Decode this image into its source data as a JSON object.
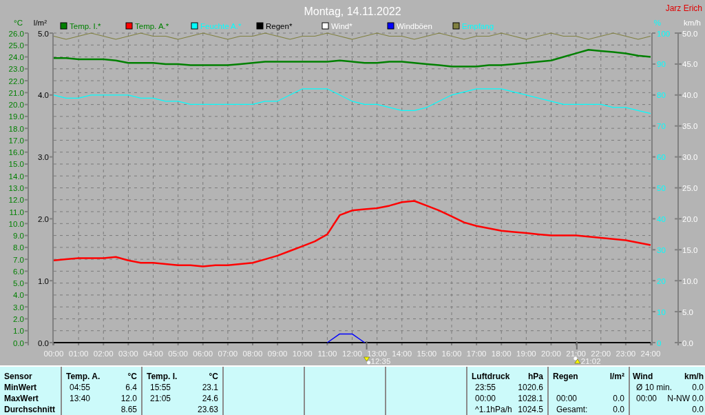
{
  "chart": {
    "author": "Jarz Erich",
    "rain_axis": {
      "title": "l/m²",
      "ticks": [
        "5.0",
        "4.0",
        "3.0",
        "2.0",
        "1.0",
        "0.0"
      ]
    },
    "markers": [
      {
        "kind": "down"
      },
      {
        "kind": "up"
      }
    ],
    "chart_data": {
      "type": "line",
      "title": "Montag, 14.11.2022",
      "grid": true,
      "legend": true,
      "xlim": [
        0,
        24
      ],
      "ylim": [
        0,
        26
      ],
      "y2lim": [
        0,
        100
      ],
      "y3lim": [
        0,
        50
      ],
      "ylabel": "°C",
      "y2label": "%",
      "y3label": "km/h",
      "x": [
        0,
        0.5,
        1,
        1.5,
        2,
        2.5,
        3,
        3.5,
        4,
        4.5,
        5,
        5.5,
        6,
        6.5,
        7,
        7.5,
        8,
        8.5,
        9,
        9.5,
        10,
        10.5,
        11,
        11.5,
        12,
        12.5,
        13,
        13.5,
        14,
        14.5,
        15,
        15.5,
        16,
        16.5,
        17,
        17.5,
        18,
        18.5,
        19,
        19.5,
        20,
        20.5,
        21,
        21.5,
        22,
        22.5,
        23,
        23.5,
        24
      ],
      "xticks": [
        {
          "value": 0,
          "label": "00:00"
        },
        {
          "value": 1,
          "label": "01:00"
        },
        {
          "value": 2,
          "label": "02:00"
        },
        {
          "value": 3,
          "label": "03:00"
        },
        {
          "value": 4,
          "label": "04:00"
        },
        {
          "value": 5,
          "label": "05:00"
        },
        {
          "value": 6,
          "label": "06:00"
        },
        {
          "value": 7,
          "label": "07:00"
        },
        {
          "value": 8,
          "label": "08:00"
        },
        {
          "value": 9,
          "label": "09:00"
        },
        {
          "value": 10,
          "label": "10:00"
        },
        {
          "value": 11,
          "label": "11:00"
        },
        {
          "value": 12,
          "label": "12:00"
        },
        {
          "value": 13,
          "label": "13:00"
        },
        {
          "value": 14,
          "label": "14:00"
        },
        {
          "value": 15,
          "label": "15:00"
        },
        {
          "value": 16,
          "label": "16:00"
        },
        {
          "value": 17,
          "label": "17:00"
        },
        {
          "value": 18,
          "label": "18:00"
        },
        {
          "value": 19,
          "label": "19:00"
        },
        {
          "value": 20,
          "label": "20:00"
        },
        {
          "value": 21,
          "label": "21:00"
        },
        {
          "value": 22,
          "label": "22:00"
        },
        {
          "value": 23,
          "label": "23:00"
        },
        {
          "value": 24,
          "label": "24:00"
        }
      ],
      "yticks": [
        {
          "value": 0,
          "label": "0.0"
        },
        {
          "value": 1,
          "label": "1.0"
        },
        {
          "value": 2,
          "label": "2.0"
        },
        {
          "value": 3,
          "label": "3.0"
        },
        {
          "value": 4,
          "label": "4.0"
        },
        {
          "value": 5,
          "label": "5.0"
        },
        {
          "value": 6,
          "label": "6.0"
        },
        {
          "value": 7,
          "label": "7.0"
        },
        {
          "value": 8,
          "label": "8.0"
        },
        {
          "value": 9,
          "label": "9.0"
        },
        {
          "value": 10,
          "label": "10.0"
        },
        {
          "value": 11,
          "label": "11.0"
        },
        {
          "value": 12,
          "label": "12.0"
        },
        {
          "value": 13,
          "label": "13.0"
        },
        {
          "value": 14,
          "label": "14.0"
        },
        {
          "value": 15,
          "label": "15.0"
        },
        {
          "value": 16,
          "label": "16.0"
        },
        {
          "value": 17,
          "label": "17.0"
        },
        {
          "value": 18,
          "label": "18.0"
        },
        {
          "value": 19,
          "label": "19.0"
        },
        {
          "value": 20,
          "label": "20.0"
        },
        {
          "value": 21,
          "label": "21.0"
        },
        {
          "value": 22,
          "label": "22.0"
        },
        {
          "value": 23,
          "label": "23.0"
        },
        {
          "value": 24,
          "label": "24.0"
        },
        {
          "value": 25,
          "label": "25.0"
        },
        {
          "value": 26,
          "label": "26.0"
        }
      ],
      "y2ticks": [
        0,
        10,
        20,
        30,
        40,
        50,
        60,
        70,
        80,
        90,
        100
      ],
      "y3ticks": [
        {
          "value": 0,
          "label": "0.0"
        },
        {
          "value": 5,
          "label": "5.0"
        },
        {
          "value": 10,
          "label": "10.0"
        },
        {
          "value": 15,
          "label": "15.0"
        },
        {
          "value": 20,
          "label": "20.0"
        },
        {
          "value": 25,
          "label": "25.0"
        },
        {
          "value": 30,
          "label": "30.0"
        },
        {
          "value": 35,
          "label": "35.0"
        },
        {
          "value": 40,
          "label": "40.0"
        },
        {
          "value": 45,
          "label": "45.0"
        },
        {
          "value": 50,
          "label": "50.0"
        }
      ],
      "series": [
        {
          "name": "Temp. I.*",
          "color": "#008000",
          "values": [
            23.9,
            23.9,
            23.8,
            23.8,
            23.8,
            23.7,
            23.5,
            23.5,
            23.5,
            23.4,
            23.4,
            23.3,
            23.3,
            23.3,
            23.3,
            23.4,
            23.5,
            23.6,
            23.6,
            23.6,
            23.6,
            23.6,
            23.6,
            23.7,
            23.6,
            23.5,
            23.5,
            23.6,
            23.6,
            23.5,
            23.4,
            23.3,
            23.2,
            23.2,
            23.2,
            23.3,
            23.3,
            23.4,
            23.5,
            23.6,
            23.7,
            24.0,
            24.3,
            24.6,
            24.5,
            24.4,
            24.3,
            24.1,
            24.0
          ]
        },
        {
          "name": "Temp. A.*",
          "color": "#ff0000",
          "values": [
            6.9,
            7.0,
            7.1,
            7.1,
            7.1,
            7.2,
            6.9,
            6.7,
            6.7,
            6.6,
            6.5,
            6.5,
            6.4,
            6.5,
            6.5,
            6.6,
            6.7,
            7.0,
            7.3,
            7.7,
            8.1,
            8.5,
            9.1,
            10.7,
            11.1,
            11.2,
            11.3,
            11.5,
            11.8,
            11.9,
            11.5,
            11.1,
            10.6,
            10.1,
            9.8,
            9.6,
            9.4,
            9.3,
            9.2,
            9.1,
            9.0,
            9.0,
            9.0,
            8.9,
            8.8,
            8.7,
            8.6,
            8.4,
            8.2
          ]
        },
        {
          "name": "Feuchte A.*",
          "color": "#00ffff",
          "axis": "y2",
          "values": [
            80,
            79,
            79,
            80,
            80,
            80,
            80,
            79,
            79,
            78,
            78,
            77,
            77,
            77,
            77,
            77,
            77,
            78,
            78,
            80,
            82,
            82,
            82,
            80,
            78,
            77,
            77,
            76,
            75,
            75,
            76,
            78,
            80,
            81,
            82,
            82,
            82,
            81,
            80,
            79,
            78,
            77,
            77,
            77,
            77,
            76,
            76,
            75,
            74
          ]
        },
        {
          "name": "Regen*",
          "color": "#000000",
          "values": [
            0,
            0,
            0,
            0,
            0,
            0,
            0,
            0,
            0,
            0,
            0,
            0,
            0,
            0,
            0,
            0,
            0,
            0,
            0,
            0,
            0,
            0,
            0,
            0,
            0,
            0,
            0,
            0,
            0,
            0,
            0,
            0,
            0,
            0,
            0,
            0,
            0,
            0,
            0,
            0,
            0,
            0,
            0,
            0,
            0,
            0,
            0,
            0,
            0
          ]
        },
        {
          "name": "Wind*",
          "color": "#ffffff",
          "axis": "y3",
          "values": [
            null,
            null,
            null,
            null,
            null,
            null,
            null,
            null,
            null,
            null,
            null,
            null,
            null,
            null,
            null,
            null,
            null,
            null,
            null,
            null,
            null,
            null,
            null,
            null,
            null,
            null,
            null,
            null,
            null,
            null,
            null,
            null,
            null,
            null,
            null,
            null,
            null,
            null,
            null,
            null,
            null,
            null,
            null,
            null,
            null,
            null,
            null,
            null,
            null
          ]
        },
        {
          "name": "Windböen",
          "color": "#0000ff",
          "axis": "y3",
          "values": [
            null,
            null,
            null,
            null,
            null,
            null,
            null,
            null,
            null,
            null,
            null,
            null,
            null,
            null,
            null,
            null,
            null,
            null,
            null,
            null,
            null,
            null,
            0,
            1.4,
            1.4,
            0,
            null,
            null,
            null,
            null,
            null,
            null,
            null,
            null,
            null,
            null,
            null,
            null,
            null,
            null,
            null,
            null,
            null,
            null,
            null,
            null,
            null,
            null,
            null
          ]
        },
        {
          "name": "Empfang",
          "color": "#808040",
          "axis": "y2",
          "values": [
            99,
            98,
            99,
            100,
            99,
            98,
            99,
            100,
            99,
            99,
            98,
            99,
            100,
            99,
            98,
            99,
            99,
            100,
            99,
            98,
            99,
            99,
            100,
            99,
            98,
            99,
            100,
            99,
            99,
            98,
            99,
            100,
            99,
            98,
            99,
            99,
            100,
            99,
            98,
            99,
            100,
            99,
            99,
            98,
            99,
            100,
            99,
            98,
            99
          ]
        }
      ],
      "annotations": [
        "12:35",
        "21:02"
      ]
    }
  },
  "table": {
    "row_labels": [
      "Sensor",
      "MinWert",
      "MaxWert",
      "Durchschnitt"
    ],
    "columns": [
      {
        "kind": "data",
        "title": "Temp. A.",
        "unit": "°C",
        "rows": [
          {
            "time": "04:55",
            "value": "6.4"
          },
          {
            "time": "13:40",
            "value": "12.0"
          },
          {
            "value": "8.65"
          }
        ]
      },
      {
        "kind": "data",
        "title": "Temp. I.",
        "unit": "°C",
        "rows": [
          {
            "time": "15:55",
            "value": "23.1"
          },
          {
            "time": "21:05",
            "value": "24.6"
          },
          {
            "value": "23.63"
          }
        ]
      },
      {
        "kind": "empty"
      },
      {
        "kind": "empty"
      },
      {
        "kind": "empty"
      },
      {
        "kind": "data",
        "title": "Luftdruck",
        "unit": "hPa",
        "rows": [
          {
            "time": "23:55",
            "value": "1020.6"
          },
          {
            "time": "00:00",
            "value": "1028.1"
          },
          {
            "time": "^1.1hPa/h",
            "value": "1024.5"
          }
        ]
      },
      {
        "kind": "data",
        "title": "Regen",
        "unit": "l/m²",
        "rows": [
          {},
          {
            "time": "00:00",
            "value": "0.0"
          },
          {
            "time": "Gesamt:",
            "value": "0.0"
          }
        ]
      },
      {
        "kind": "data",
        "title": "Wind",
        "unit": "km/h",
        "rows": [
          {
            "time": "Ø 10 min.",
            "value": "0.0"
          },
          {
            "time": "00:00",
            "value": "N-NW 0.0"
          },
          {
            "value": "0.0"
          }
        ]
      }
    ]
  }
}
